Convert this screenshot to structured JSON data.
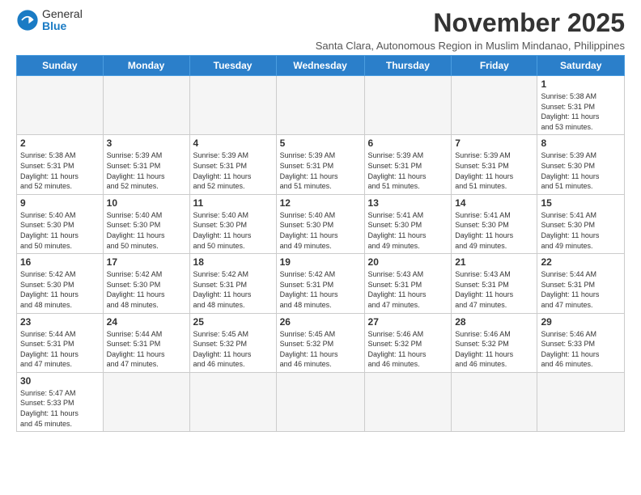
{
  "header": {
    "logo_general": "General",
    "logo_blue": "Blue",
    "month_title": "November 2025",
    "subtitle": "Santa Clara, Autonomous Region in Muslim Mindanao, Philippines"
  },
  "days_of_week": [
    "Sunday",
    "Monday",
    "Tuesday",
    "Wednesday",
    "Thursday",
    "Friday",
    "Saturday"
  ],
  "cells": [
    {
      "day": "",
      "info": ""
    },
    {
      "day": "",
      "info": ""
    },
    {
      "day": "",
      "info": ""
    },
    {
      "day": "",
      "info": ""
    },
    {
      "day": "",
      "info": ""
    },
    {
      "day": "",
      "info": ""
    },
    {
      "day": "1",
      "info": "Sunrise: 5:38 AM\nSunset: 5:31 PM\nDaylight: 11 hours\nand 53 minutes."
    },
    {
      "day": "2",
      "info": "Sunrise: 5:38 AM\nSunset: 5:31 PM\nDaylight: 11 hours\nand 52 minutes."
    },
    {
      "day": "3",
      "info": "Sunrise: 5:39 AM\nSunset: 5:31 PM\nDaylight: 11 hours\nand 52 minutes."
    },
    {
      "day": "4",
      "info": "Sunrise: 5:39 AM\nSunset: 5:31 PM\nDaylight: 11 hours\nand 52 minutes."
    },
    {
      "day": "5",
      "info": "Sunrise: 5:39 AM\nSunset: 5:31 PM\nDaylight: 11 hours\nand 51 minutes."
    },
    {
      "day": "6",
      "info": "Sunrise: 5:39 AM\nSunset: 5:31 PM\nDaylight: 11 hours\nand 51 minutes."
    },
    {
      "day": "7",
      "info": "Sunrise: 5:39 AM\nSunset: 5:31 PM\nDaylight: 11 hours\nand 51 minutes."
    },
    {
      "day": "8",
      "info": "Sunrise: 5:39 AM\nSunset: 5:30 PM\nDaylight: 11 hours\nand 51 minutes."
    },
    {
      "day": "9",
      "info": "Sunrise: 5:40 AM\nSunset: 5:30 PM\nDaylight: 11 hours\nand 50 minutes."
    },
    {
      "day": "10",
      "info": "Sunrise: 5:40 AM\nSunset: 5:30 PM\nDaylight: 11 hours\nand 50 minutes."
    },
    {
      "day": "11",
      "info": "Sunrise: 5:40 AM\nSunset: 5:30 PM\nDaylight: 11 hours\nand 50 minutes."
    },
    {
      "day": "12",
      "info": "Sunrise: 5:40 AM\nSunset: 5:30 PM\nDaylight: 11 hours\nand 49 minutes."
    },
    {
      "day": "13",
      "info": "Sunrise: 5:41 AM\nSunset: 5:30 PM\nDaylight: 11 hours\nand 49 minutes."
    },
    {
      "day": "14",
      "info": "Sunrise: 5:41 AM\nSunset: 5:30 PM\nDaylight: 11 hours\nand 49 minutes."
    },
    {
      "day": "15",
      "info": "Sunrise: 5:41 AM\nSunset: 5:30 PM\nDaylight: 11 hours\nand 49 minutes."
    },
    {
      "day": "16",
      "info": "Sunrise: 5:42 AM\nSunset: 5:30 PM\nDaylight: 11 hours\nand 48 minutes."
    },
    {
      "day": "17",
      "info": "Sunrise: 5:42 AM\nSunset: 5:30 PM\nDaylight: 11 hours\nand 48 minutes."
    },
    {
      "day": "18",
      "info": "Sunrise: 5:42 AM\nSunset: 5:31 PM\nDaylight: 11 hours\nand 48 minutes."
    },
    {
      "day": "19",
      "info": "Sunrise: 5:42 AM\nSunset: 5:31 PM\nDaylight: 11 hours\nand 48 minutes."
    },
    {
      "day": "20",
      "info": "Sunrise: 5:43 AM\nSunset: 5:31 PM\nDaylight: 11 hours\nand 47 minutes."
    },
    {
      "day": "21",
      "info": "Sunrise: 5:43 AM\nSunset: 5:31 PM\nDaylight: 11 hours\nand 47 minutes."
    },
    {
      "day": "22",
      "info": "Sunrise: 5:44 AM\nSunset: 5:31 PM\nDaylight: 11 hours\nand 47 minutes."
    },
    {
      "day": "23",
      "info": "Sunrise: 5:44 AM\nSunset: 5:31 PM\nDaylight: 11 hours\nand 47 minutes."
    },
    {
      "day": "24",
      "info": "Sunrise: 5:44 AM\nSunset: 5:31 PM\nDaylight: 11 hours\nand 47 minutes."
    },
    {
      "day": "25",
      "info": "Sunrise: 5:45 AM\nSunset: 5:32 PM\nDaylight: 11 hours\nand 46 minutes."
    },
    {
      "day": "26",
      "info": "Sunrise: 5:45 AM\nSunset: 5:32 PM\nDaylight: 11 hours\nand 46 minutes."
    },
    {
      "day": "27",
      "info": "Sunrise: 5:46 AM\nSunset: 5:32 PM\nDaylight: 11 hours\nand 46 minutes."
    },
    {
      "day": "28",
      "info": "Sunrise: 5:46 AM\nSunset: 5:32 PM\nDaylight: 11 hours\nand 46 minutes."
    },
    {
      "day": "29",
      "info": "Sunrise: 5:46 AM\nSunset: 5:33 PM\nDaylight: 11 hours\nand 46 minutes."
    },
    {
      "day": "30",
      "info": "Sunrise: 5:47 AM\nSunset: 5:33 PM\nDaylight: 11 hours\nand 45 minutes."
    },
    {
      "day": "",
      "info": ""
    },
    {
      "day": "",
      "info": ""
    },
    {
      "day": "",
      "info": ""
    },
    {
      "day": "",
      "info": ""
    },
    {
      "day": "",
      "info": ""
    },
    {
      "day": "",
      "info": ""
    }
  ]
}
